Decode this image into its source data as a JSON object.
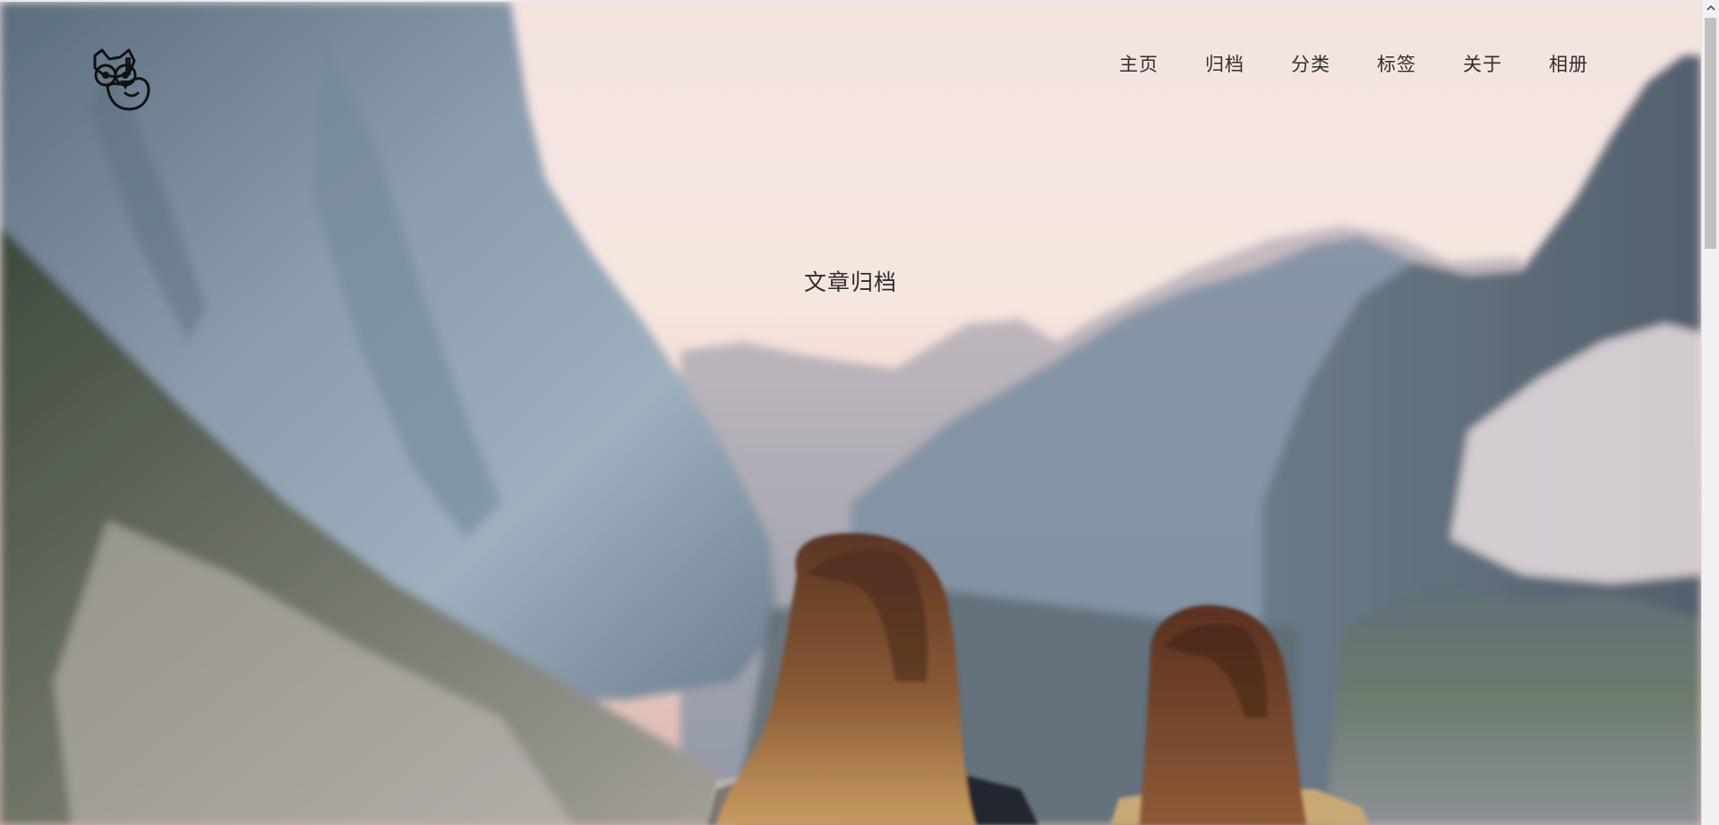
{
  "header": {
    "logo_icon": "dog-face-icon",
    "nav": [
      {
        "label": "主页"
      },
      {
        "label": "归档"
      },
      {
        "label": "分类"
      },
      {
        "label": "标签"
      },
      {
        "label": "关于"
      },
      {
        "label": "相册"
      }
    ]
  },
  "hero": {
    "title": "文章归档",
    "background": "mountain-valley-photo"
  },
  "colors": {
    "nav_text": "#2e2e2e",
    "title_text": "#2d2d2d",
    "sky": "#f3dcd6",
    "cliff": "#6f8499"
  },
  "scrollbar": {
    "up_icon": "chevron-up-icon"
  }
}
